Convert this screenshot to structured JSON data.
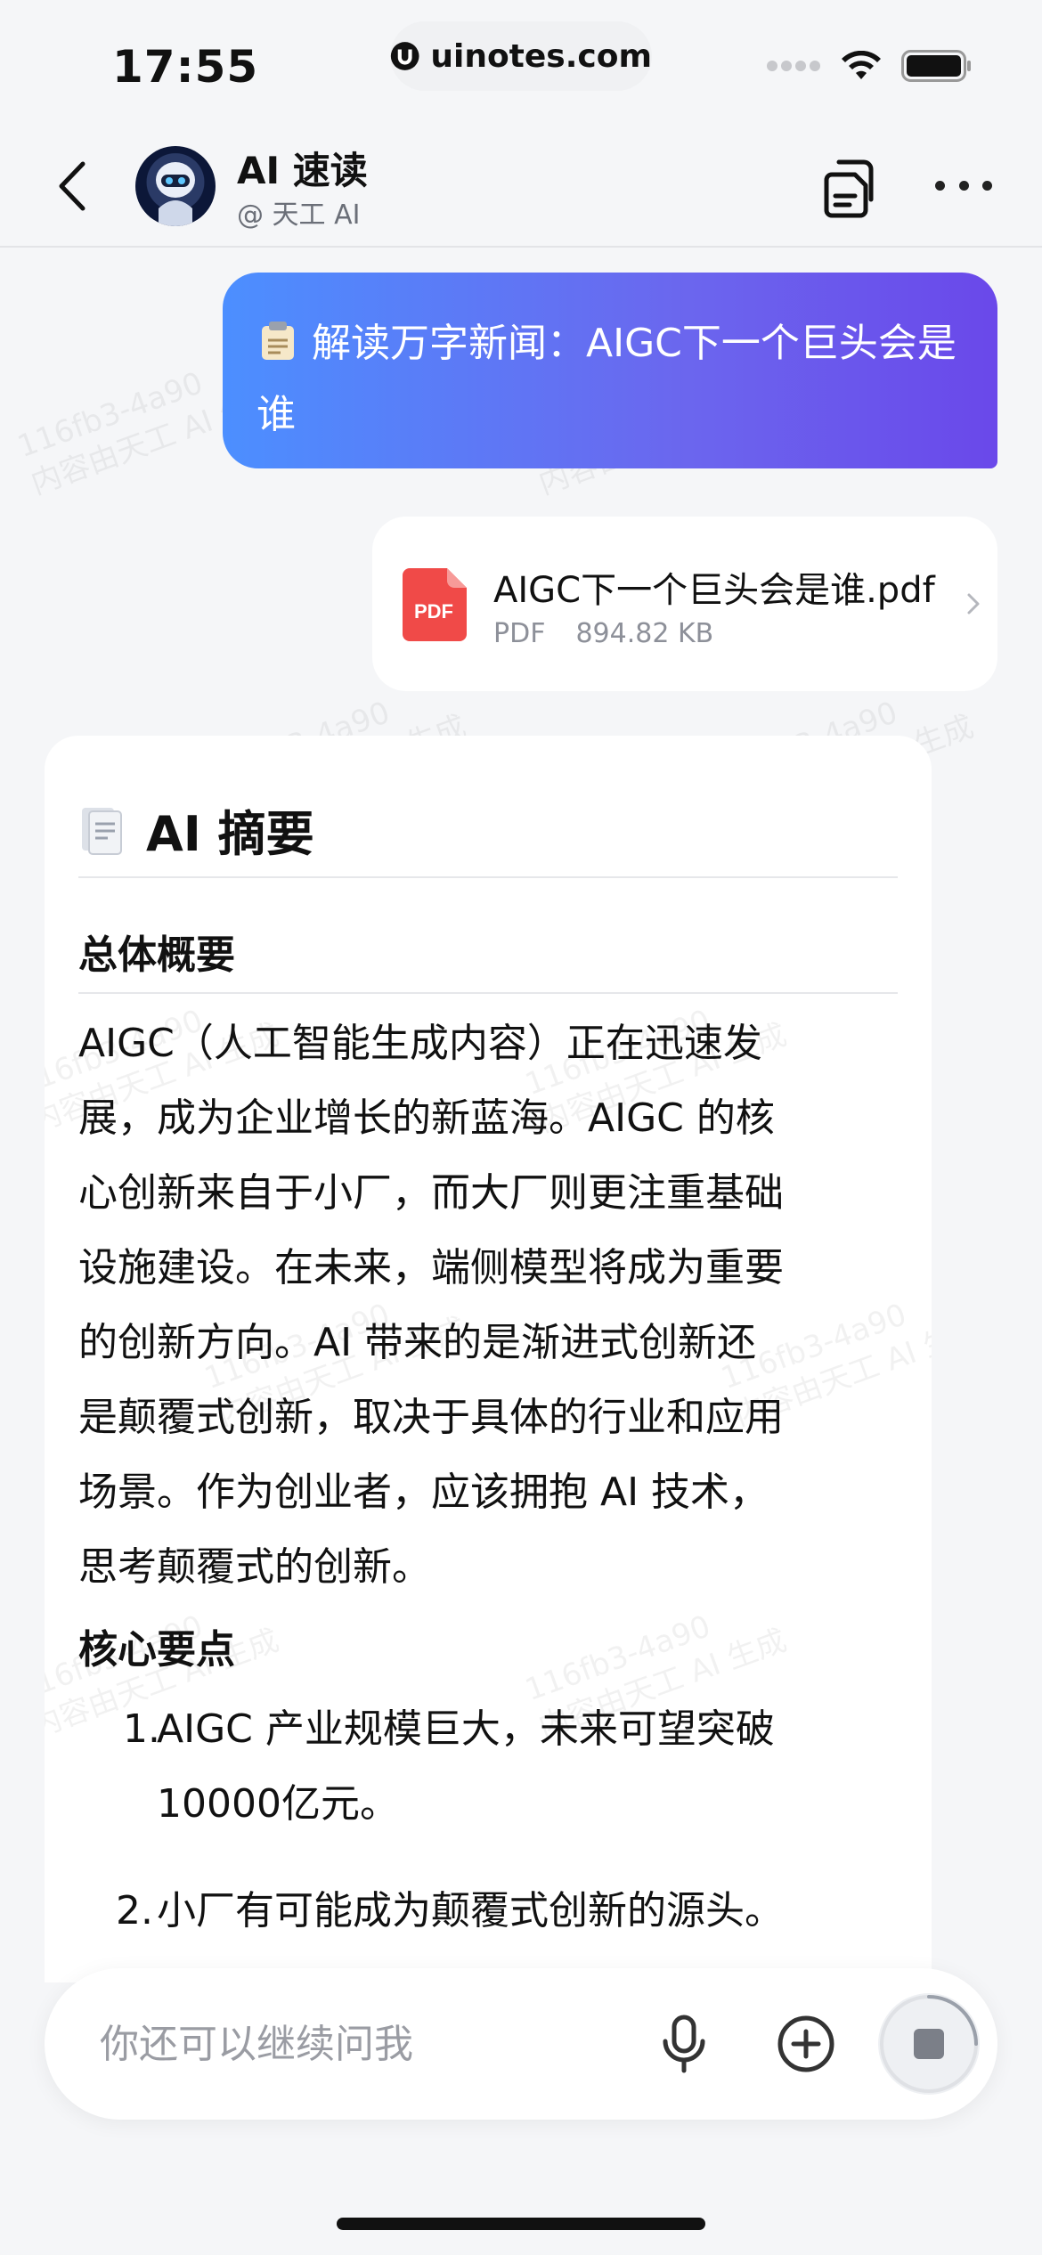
{
  "status_bar": {
    "time": "17:55",
    "url": "uinotes.com",
    "icons": [
      "signal-dots-icon",
      "wifi-icon",
      "battery-icon"
    ]
  },
  "header": {
    "back_icon": "chevron-left-icon",
    "bot_name": "AI 速读",
    "bot_sub": "@ 天工 AI",
    "actions": [
      "documents-icon",
      "more-icon"
    ]
  },
  "user_message": {
    "icon": "clipboard-icon",
    "text": "解读万字新闻：AIGC下一个巨头会是谁"
  },
  "file_card": {
    "name": "AIGC下一个巨头会是谁.pdf",
    "type": "PDF",
    "size": "894.82 KB",
    "type_badge": "PDF"
  },
  "summary": {
    "title": "AI 摘要",
    "overview_heading": "总体概要",
    "overview_lines": [
      "AIGC（人工智能生成内容）正在迅速发",
      "展，成为企业增长的新蓝海。AIGC 的核",
      "心创新来自于小厂，而大厂则更注重基础",
      "设施建设。在未来，端侧模型将成为重要",
      "的创新方向。AI 带来的是渐进式创新还",
      "是颠覆式创新，取决于具体的行业和应用",
      "场景。作为创业者，应该拥抱 AI 技术，",
      "思考颠覆式的创新。"
    ],
    "key_points_heading": "核心要点",
    "key_points": [
      {
        "num": "1.",
        "lines": [
          "AIGC 产业规模巨大，未来可望突破",
          "10000亿元。"
        ]
      },
      {
        "num": "2.",
        "lines": [
          "小厂有可能成为颠覆式创新的源头。"
        ]
      }
    ]
  },
  "watermark": {
    "line1": "116fb3-4a90",
    "line2": "内容由天工 AI 生成"
  },
  "input_bar": {
    "placeholder": "你还可以继续问我",
    "value": ""
  },
  "colors": {
    "bubble_start": "#4c8fff",
    "bubble_end": "#6a48ea",
    "pdf_red": "#f04a48",
    "background": "#f5f6f8"
  }
}
